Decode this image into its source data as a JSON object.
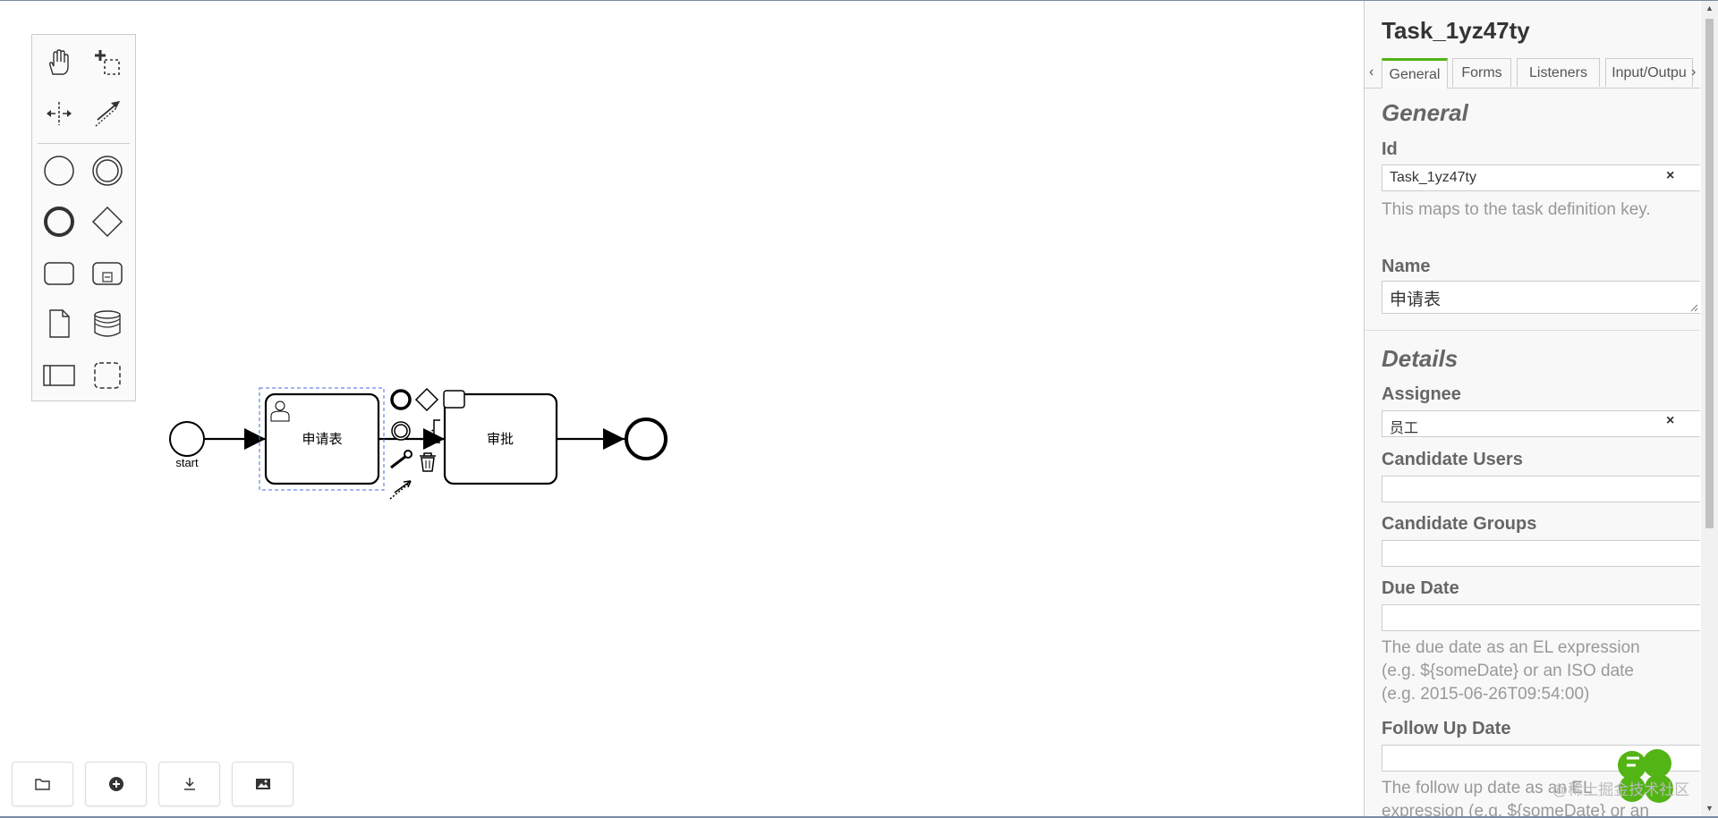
{
  "diagram": {
    "start_label": "start",
    "task1_label": "申请表",
    "task2_label": "审批"
  },
  "toolbar": {
    "buttons": [
      "open-file",
      "create-new",
      "download",
      "export-image"
    ]
  },
  "panel": {
    "title": "Task_1yz47ty",
    "tabs": [
      "General",
      "Forms",
      "Listeners",
      "Input/Outpu"
    ],
    "active_tab": "General",
    "general_group": "General",
    "id_label": "Id",
    "id_value": "Task_1yz47ty",
    "id_desc": "This maps to the task definition key.",
    "name_label": "Name",
    "name_value": "申请表",
    "details_group": "Details",
    "assignee_label": "Assignee",
    "assignee_value": "员工",
    "candidate_users_label": "Candidate Users",
    "candidate_groups_label": "Candidate Groups",
    "due_date_label": "Due Date",
    "due_date_desc": "The due date as an EL expression (e.g. ${someDate} or an ISO date (e.g. 2015-06-26T09:54:00)",
    "follow_up_label": "Follow Up Date",
    "follow_up_desc": "The follow up date as an EL expression (e.g. ${someDate} or an"
  },
  "watermark": "@稀土掘金技术社区",
  "colors": {
    "accent": "#52b415",
    "selection": "#4a6ae0"
  }
}
